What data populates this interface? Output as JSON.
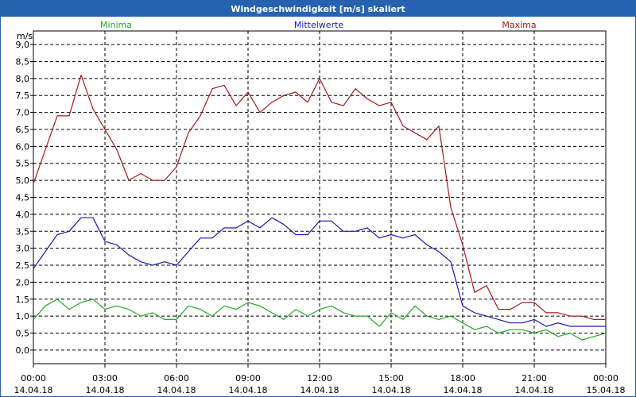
{
  "chart_data": {
    "type": "line",
    "title": "Windgeschwindigkeit [m/s] skaliert",
    "ylabel": "m/s",
    "ylim": [
      -0.4,
      9.4
    ],
    "yticks": [
      "0,0",
      "0,5",
      "1,0",
      "1,5",
      "2,0",
      "2,5",
      "3,0",
      "3,5",
      "4,0",
      "4,5",
      "5,0",
      "5,5",
      "6,0",
      "6,5",
      "7,0",
      "7,5",
      "8,0",
      "8,5",
      "9,0"
    ],
    "xticks": [
      {
        "time": "00:00",
        "date": "14.04.18"
      },
      {
        "time": "03:00",
        "date": "14.04.18"
      },
      {
        "time": "06:00",
        "date": "14.04.18"
      },
      {
        "time": "09:00",
        "date": "14.04.18"
      },
      {
        "time": "12:00",
        "date": "14.04.18"
      },
      {
        "time": "15:00",
        "date": "14.04.18"
      },
      {
        "time": "18:00",
        "date": "14.04.18"
      },
      {
        "time": "21:00",
        "date": "14.04.18"
      },
      {
        "time": "00:00",
        "date": "15.04.18"
      }
    ],
    "grid": true,
    "x_hours": [
      0,
      0.5,
      1,
      1.5,
      2,
      2.5,
      3,
      3.5,
      4,
      4.5,
      5,
      5.5,
      6,
      6.5,
      7,
      7.5,
      8,
      8.5,
      9,
      9.5,
      10,
      10.5,
      11,
      11.5,
      12,
      12.5,
      13,
      13.5,
      14,
      14.5,
      15,
      15.5,
      16,
      16.5,
      17,
      17.5,
      18,
      18.5,
      19,
      19.5,
      20,
      20.5,
      21,
      21.5,
      22,
      22.5,
      23,
      23.5,
      24
    ],
    "series": [
      {
        "name": "Minima",
        "color": "#22aa22",
        "values": [
          0.9,
          1.3,
          1.5,
          1.2,
          1.4,
          1.5,
          1.2,
          1.3,
          1.2,
          1.0,
          1.1,
          0.9,
          0.9,
          1.3,
          1.2,
          1.0,
          1.3,
          1.2,
          1.4,
          1.3,
          1.1,
          0.9,
          1.2,
          1.0,
          1.2,
          1.3,
          1.1,
          1.0,
          1.0,
          0.7,
          1.1,
          0.9,
          1.3,
          1.0,
          0.9,
          1.0,
          0.8,
          0.6,
          0.7,
          0.5,
          0.6,
          0.6,
          0.5,
          0.6,
          0.4,
          0.5,
          0.3,
          0.4,
          0.5
        ]
      },
      {
        "name": "Mittelwerte",
        "color": "#1a1ab8",
        "values": [
          2.4,
          2.9,
          3.4,
          3.5,
          3.9,
          3.9,
          3.2,
          3.1,
          2.8,
          2.6,
          2.5,
          2.6,
          2.5,
          2.9,
          3.3,
          3.3,
          3.6,
          3.6,
          3.8,
          3.6,
          3.9,
          3.7,
          3.4,
          3.4,
          3.8,
          3.8,
          3.5,
          3.5,
          3.6,
          3.3,
          3.4,
          3.3,
          3.4,
          3.1,
          2.9,
          2.6,
          1.3,
          1.1,
          1.0,
          0.9,
          0.8,
          0.8,
          0.9,
          0.7,
          0.8,
          0.7,
          0.7,
          0.7,
          0.7
        ]
      },
      {
        "name": "Maxima",
        "color": "#aa1a1a",
        "values": [
          4.9,
          5.9,
          6.9,
          6.9,
          8.1,
          7.1,
          6.5,
          5.9,
          5.0,
          5.2,
          5.0,
          5.0,
          5.4,
          6.4,
          6.9,
          7.7,
          7.8,
          7.2,
          7.6,
          7.0,
          7.3,
          7.5,
          7.6,
          7.3,
          8.0,
          7.3,
          7.2,
          7.7,
          7.4,
          7.2,
          7.3,
          6.6,
          6.4,
          6.2,
          6.6,
          4.2,
          3.1,
          1.7,
          1.9,
          1.2,
          1.2,
          1.4,
          1.4,
          1.1,
          1.1,
          1.0,
          1.0,
          0.9,
          0.9
        ]
      }
    ]
  }
}
